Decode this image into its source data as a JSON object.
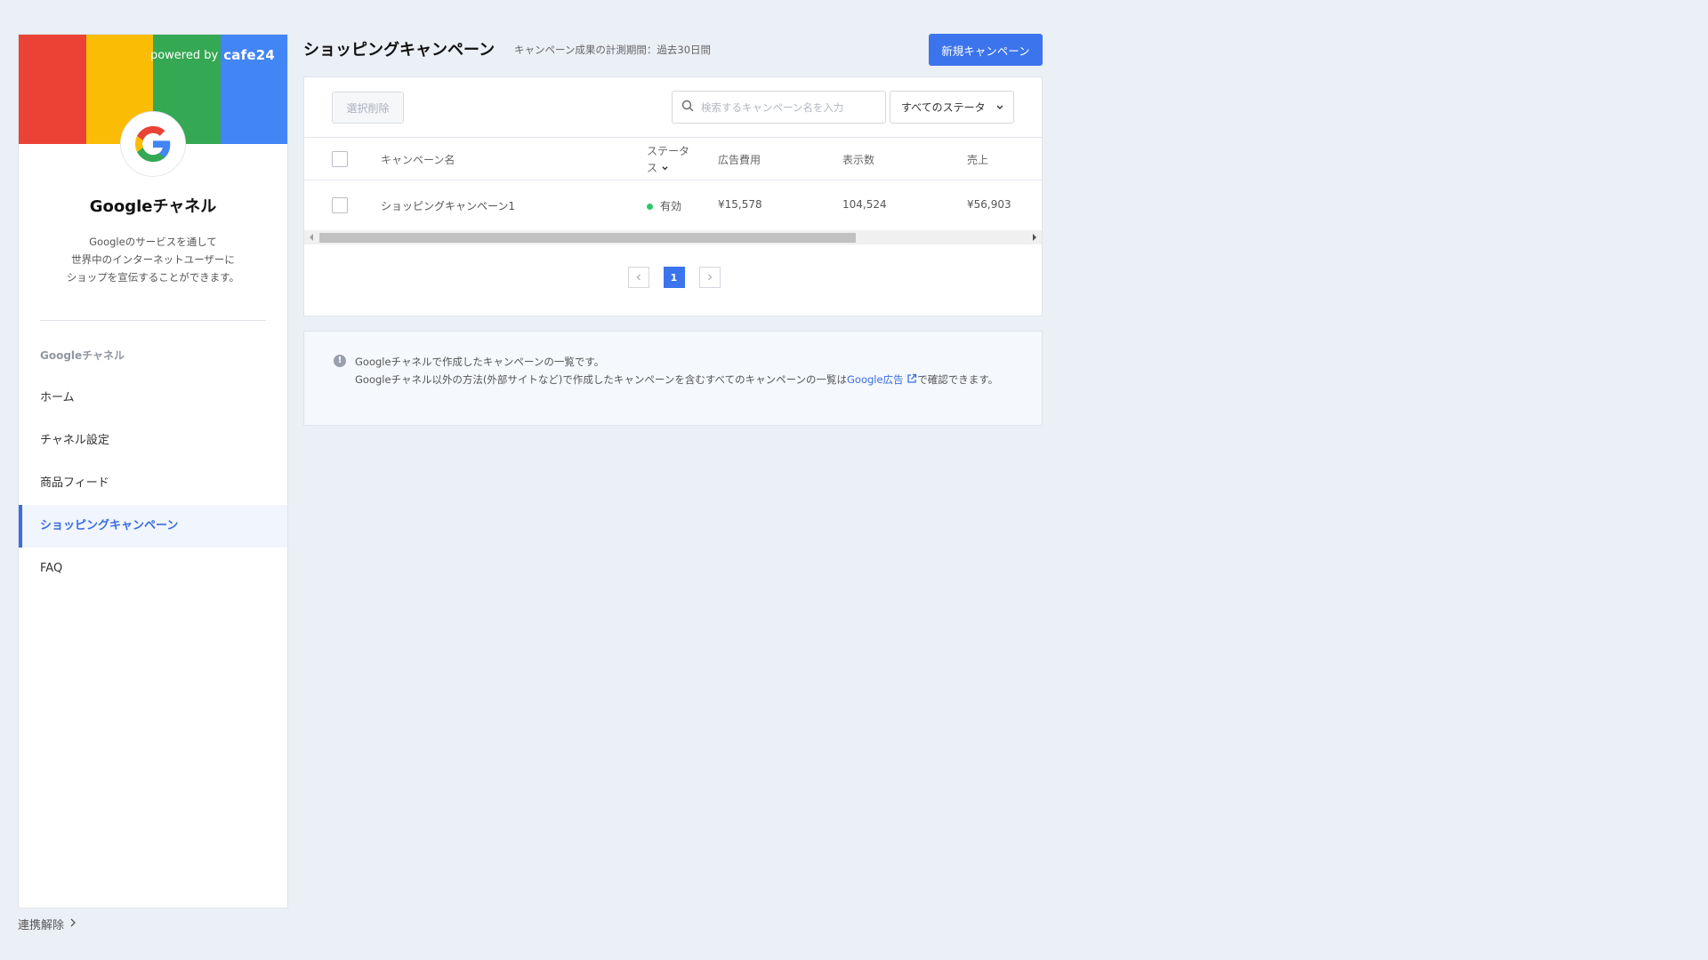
{
  "sidebar": {
    "banner_colors": [
      "#ea4335",
      "#fbbc05",
      "#34a853",
      "#4285f4"
    ],
    "powered_by": "powered by",
    "brand": "cafe24",
    "channel_title": "Googleチャネル",
    "description_lines": [
      "Googleのサービスを通して",
      "世界中のインターネットユーザーに",
      "ショップを宣伝することができます。"
    ],
    "section_label": "Googleチャネル",
    "items": [
      {
        "label": "ホーム"
      },
      {
        "label": "チャネル設定"
      },
      {
        "label": "商品フィード"
      },
      {
        "label": "ショッピングキャンペーン"
      },
      {
        "label": "FAQ"
      }
    ],
    "active_index": 3,
    "disconnect": "連携解除"
  },
  "header": {
    "title": "ショッピングキャンペーン",
    "subtitle": "キャンペーン成果の計測期間：過去30日間",
    "new_button": "新規キャンペーン"
  },
  "toolbar": {
    "delete_button": "選択削除",
    "search_placeholder": "検索するキャンペーン名を入力",
    "status_select": "すべてのステータ"
  },
  "table": {
    "columns": {
      "name": "キャンペーン名",
      "status_line1": "ステータ",
      "status_line2": "ス",
      "cost": "広告費用",
      "impressions": "表示数",
      "sales": "売上"
    },
    "rows": [
      {
        "name": "ショッピングキャンペーン1",
        "status": "有効",
        "cost": "¥15,578",
        "impressions": "104,524",
        "sales": "¥56,903"
      }
    ]
  },
  "pagination": {
    "current": "1"
  },
  "info": {
    "line1": "Googleチャネルで作成したキャンペーンの一覧です。",
    "line2_before": "Googleチャネル以外の方法(外部サイトなど)で作成したキャンペーンを含むすべてのキャンペーンの一覧は",
    "link": "Google広告",
    "line2_after": "で確認できます。"
  },
  "colors": {
    "accent": "#3b74ec",
    "active": "#3b6de0",
    "status_ok": "#2ec66a"
  }
}
